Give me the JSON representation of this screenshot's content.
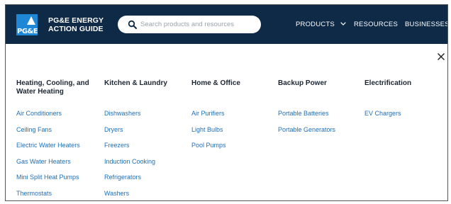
{
  "header": {
    "logo_text": "PG&E",
    "brand_line1": "PG&E ENERGY",
    "brand_line2": "ACTION GUIDE",
    "search": {
      "placeholder": "Search products and resources",
      "value": ""
    },
    "nav": {
      "products": "PRODUCTS",
      "resources": "RESOURCES",
      "businesses": "BUSINESSES"
    },
    "colors": {
      "bar": "#0e2a47",
      "logo": "#1e88d6"
    }
  },
  "menu": {
    "close_icon": "close-icon",
    "columns": [
      {
        "heading": "Heating, Cooling, and Water Heating",
        "links": [
          "Air Conditioners",
          "Ceiling Fans",
          "Electric Water Heaters",
          "Gas Water Heaters",
          "Mini Split Heat Pumps",
          "Thermostats"
        ]
      },
      {
        "heading": "Kitchen & Laundry",
        "links": [
          "Dishwashers",
          "Dryers",
          "Freezers",
          "Induction Cooking",
          "Refrigerators",
          "Washers"
        ]
      },
      {
        "heading": "Home & Office",
        "links": [
          "Air Purifiers",
          "Light Bulbs",
          "Pool Pumps"
        ]
      },
      {
        "heading": "Backup Power",
        "links": [
          "Portable Batteries",
          "Portable Generators"
        ]
      },
      {
        "heading": "Electrification",
        "links": [
          "EV Chargers"
        ]
      }
    ]
  }
}
